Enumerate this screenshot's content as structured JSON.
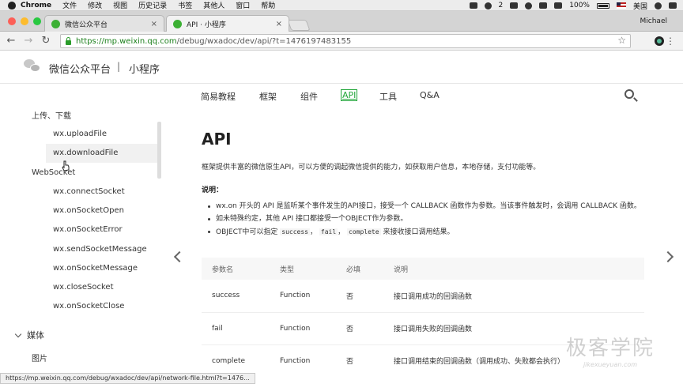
{
  "menubar": {
    "app": "Chrome",
    "items": [
      "文件",
      "修改",
      "视图",
      "历史记录",
      "书签",
      "其他人",
      "窗口",
      "帮助"
    ],
    "battery": "100%",
    "input_method": "美国",
    "badge": "2"
  },
  "tabs": [
    {
      "title": "微信公众平台",
      "active": false
    },
    {
      "title": "API · 小程序",
      "active": true
    }
  ],
  "profile": {
    "name": "Michael"
  },
  "address": {
    "host": "https://mp.weixin.qq.com",
    "path": "/debug/wxadoc/dev/api/?t=1476197483155"
  },
  "site": {
    "title": "微信公众平台",
    "separator": "|",
    "subtitle": "小程序"
  },
  "topnav": {
    "items": [
      "简易教程",
      "框架",
      "组件",
      "API",
      "工具",
      "Q&A"
    ],
    "active": "API"
  },
  "sidebar": {
    "group1": "上传、下载",
    "group1_items": [
      "wx.uploadFile",
      "wx.downloadFile"
    ],
    "group2": "WebSocket",
    "group2_items": [
      "wx.connectSocket",
      "wx.onSocketOpen",
      "wx.onSocketError",
      "wx.sendSocketMessage",
      "wx.onSocketMessage",
      "wx.closeSocket",
      "wx.onSocketClose"
    ],
    "section": "媒体",
    "section_item": "图片"
  },
  "content": {
    "title": "API",
    "intro": "框架提供丰富的微信原生API，可以方便的调起微信提供的能力，如获取用户信息，本地存储，支付功能等。",
    "note_label": "说明：",
    "bullet1": "wx.on 开头的 API 是监听某个事件发生的API接口，接受一个 CALLBACK 函数作为参数。当该事件触发时，会调用 CALLBACK 函数。",
    "bullet2": "如未特殊约定，其他 API 接口都接受一个OBJECT作为参数。",
    "bullet3_pre": "OBJECT中可以指定",
    "bullet3_code1": "success",
    "bullet3_code2": "fail",
    "bullet3_code3": "complete",
    "bullet3_post": "来接收接口调用结果。",
    "comma": "，",
    "table": {
      "headers": [
        "参数名",
        "类型",
        "必填",
        "说明"
      ],
      "rows": [
        [
          "success",
          "Function",
          "否",
          "接口调用成功的回调函数"
        ],
        [
          "fail",
          "Function",
          "否",
          "接口调用失败的回调函数"
        ],
        [
          "complete",
          "Function",
          "否",
          "接口调用结束的回调函数（调用成功、失败都会执行）"
        ]
      ]
    }
  },
  "statusbar": "https://mp.weixin.qq.com/debug/wxadoc/dev/api/network-file.html?t=1476...",
  "watermark": {
    "line1": "极客学院",
    "line2": "jikexueyuan.com"
  }
}
